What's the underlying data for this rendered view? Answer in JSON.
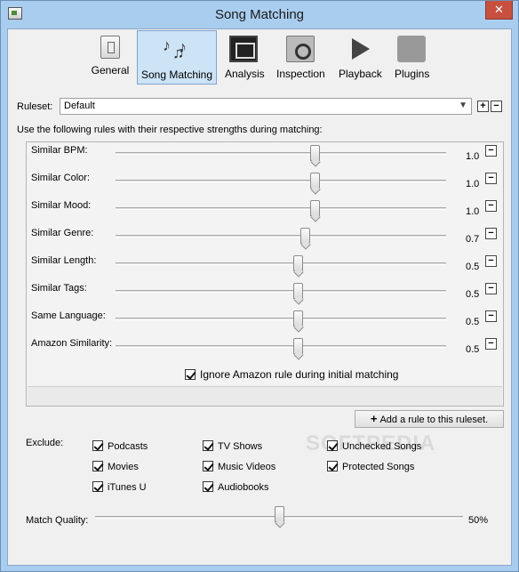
{
  "window": {
    "title": "Song Matching",
    "close_glyph": "✕"
  },
  "toolbar": {
    "tabs": [
      {
        "label": "General",
        "icon": "switch-icon"
      },
      {
        "label": "Song Matching",
        "icon": "music-notes-icon",
        "active": true
      },
      {
        "label": "Analysis",
        "icon": "monitor-chart-icon"
      },
      {
        "label": "Inspection",
        "icon": "magnifier-icon"
      },
      {
        "label": "Playback",
        "icon": "play-icon"
      },
      {
        "label": "Plugins",
        "icon": "puzzle-icon"
      }
    ]
  },
  "ruleset": {
    "label": "Ruleset:",
    "selected": "Default",
    "add_glyph": "+",
    "remove_glyph": "−"
  },
  "instructions": "Use the following rules with their respective strengths during matching:",
  "rules": [
    {
      "name": "Similar BPM:",
      "value": "1.0",
      "level": 1.0
    },
    {
      "name": "Similar Color:",
      "value": "1.0",
      "level": 1.0
    },
    {
      "name": "Similar Mood:",
      "value": "1.0",
      "level": 1.0
    },
    {
      "name": "Similar Genre:",
      "value": "0.7",
      "level": 0.7
    },
    {
      "name": "Similar Length:",
      "value": "0.5",
      "level": 0.5
    },
    {
      "name": "Similar Tags:",
      "value": "0.5",
      "level": 0.5
    },
    {
      "name": "Same Language:",
      "value": "0.5",
      "level": 0.5
    },
    {
      "name": "Amazon Similarity:",
      "value": "0.5",
      "level": 0.5
    }
  ],
  "rule_remove_glyph": "−",
  "ignore_amazon": {
    "label": "Ignore Amazon rule during initial matching",
    "checked": true
  },
  "add_rule": {
    "glyph": "+",
    "label": "Add a rule to this ruleset."
  },
  "exclude": {
    "label": "Exclude:",
    "items": [
      {
        "label": "Podcasts",
        "checked": true
      },
      {
        "label": "TV Shows",
        "checked": true
      },
      {
        "label": "Unchecked Songs",
        "checked": true
      },
      {
        "label": "Movies",
        "checked": true
      },
      {
        "label": "Music Videos",
        "checked": true
      },
      {
        "label": "Protected Songs",
        "checked": true
      },
      {
        "label": "iTunes U",
        "checked": true
      },
      {
        "label": "Audiobooks",
        "checked": true
      }
    ]
  },
  "match_quality": {
    "label": "Match Quality:",
    "value": "50%",
    "level": 0.5
  },
  "watermark": "SOFTPEDIA"
}
